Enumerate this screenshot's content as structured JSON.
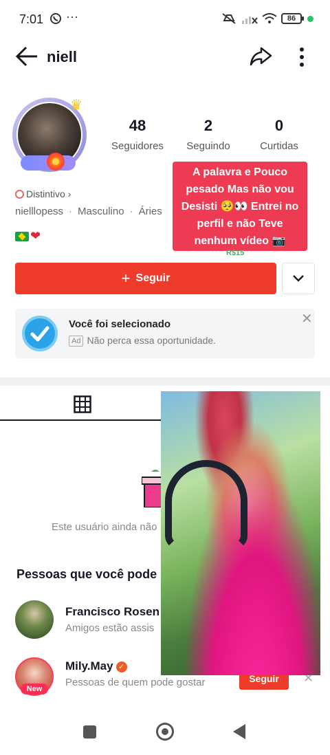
{
  "status_bar": {
    "time": "7:01",
    "battery": "86"
  },
  "header": {
    "username": "niell"
  },
  "stats": [
    {
      "value": "48",
      "label": "Seguidores"
    },
    {
      "value": "2",
      "label": "Seguindo"
    },
    {
      "value": "0",
      "label": "Curtidas"
    }
  ],
  "profile": {
    "badge_label": "Distintivo",
    "handle": "nielllopess",
    "gender": "Masculino",
    "sign": "Áries"
  },
  "overlay_caption": {
    "lines": [
      "A palavra e Pouco",
      "pesado Mas não vou",
      "Desisti 🥺👀 Entrei no",
      "perfil e não Teve",
      "nenhum vídeo 📷"
    ],
    "sticker": "R$15"
  },
  "follow": {
    "label": "Seguir"
  },
  "ad": {
    "title": "Você foi selecionado",
    "tag": "Ad",
    "subtitle": "Não perca essa oportunidade."
  },
  "empty_state": {
    "text": "Este usuário ainda não"
  },
  "suggestions": {
    "title": "Pessoas que você pode g",
    "people": [
      {
        "name": "Francisco Rosen",
        "subtitle": "Amigos estão assis"
      },
      {
        "name": "Mily.May",
        "subtitle": "Pessoas de quem pode gostar",
        "badge": "New",
        "action": "Seguir"
      }
    ]
  },
  "colors": {
    "accent": "#ef3b2c",
    "caption_bg": "#ee3b54",
    "ad_check": "#2aa3e8"
  }
}
